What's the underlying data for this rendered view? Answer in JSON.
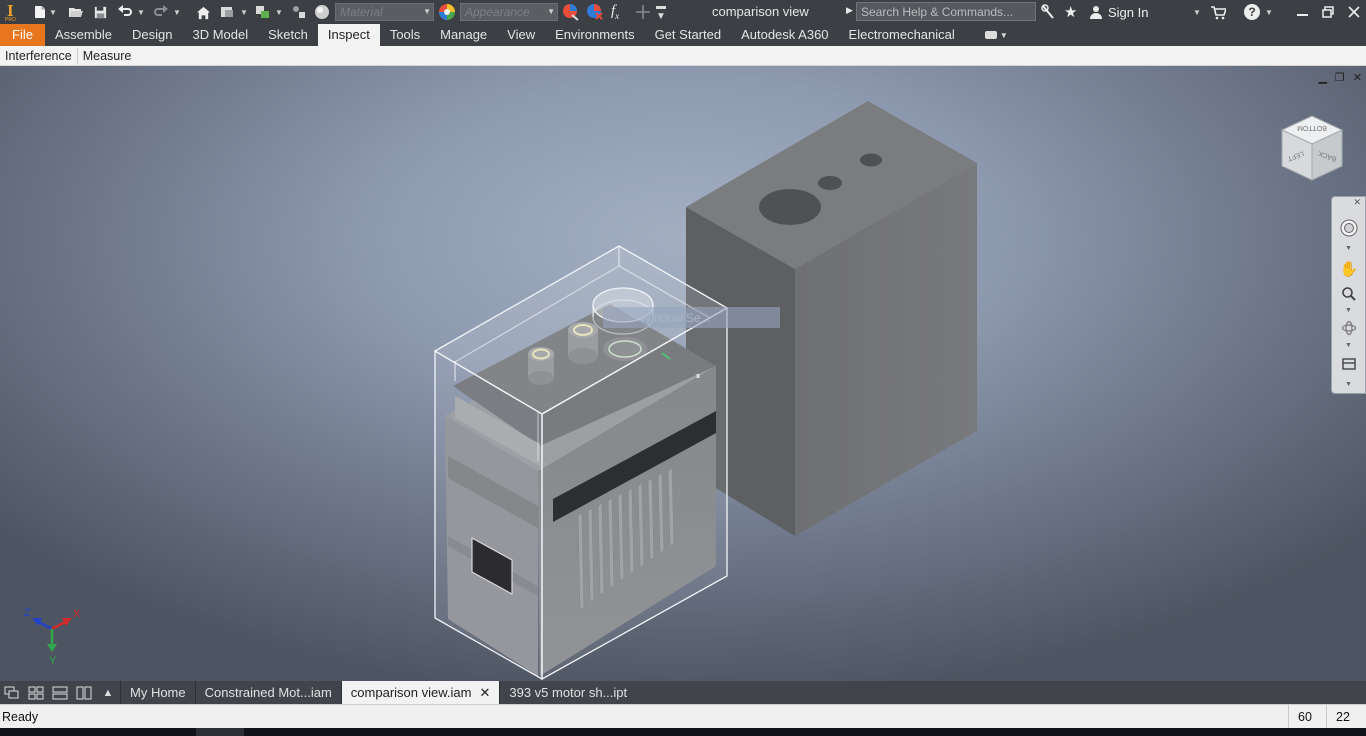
{
  "app": {
    "edition_badge": "PRO",
    "document_title": "comparison view",
    "material_placeholder": "Material",
    "appearance_placeholder": "Appearance",
    "search_placeholder": "Search Help & Commands...",
    "sign_in_label": "Sign In",
    "help_label": "?"
  },
  "ribbon": {
    "tabs": [
      {
        "label": "File"
      },
      {
        "label": "Assemble"
      },
      {
        "label": "Design"
      },
      {
        "label": "3D Model"
      },
      {
        "label": "Sketch"
      },
      {
        "label": "Inspect"
      },
      {
        "label": "Tools"
      },
      {
        "label": "Manage"
      },
      {
        "label": "View"
      },
      {
        "label": "Environments"
      },
      {
        "label": "Get Started"
      },
      {
        "label": "Autodesk A360"
      },
      {
        "label": "Electromechanical"
      }
    ],
    "active_tab": "Inspect",
    "panels": [
      {
        "label": "Interference"
      },
      {
        "label": "Measure"
      }
    ]
  },
  "viewport": {
    "tooltip": "Window Se...",
    "viewcube_faces": [
      "BOTTOM",
      "LEFT",
      "BACK"
    ],
    "triad_axes": [
      "Z",
      "X",
      "Y"
    ]
  },
  "document_tabs": [
    {
      "label": "My Home"
    },
    {
      "label": "Constrained Mot...iam"
    },
    {
      "label": "comparison view.iam",
      "active": true
    },
    {
      "label": "393 v5 motor sh...ipt"
    }
  ],
  "status": {
    "text": "Ready",
    "count_a": "60",
    "count_b": "22"
  },
  "colors": {
    "file_tab": "#e8761f",
    "chrome_dark": "#3c3f44",
    "ribbon_light": "#f3f3f3",
    "part_gray": "#6e6f72"
  }
}
